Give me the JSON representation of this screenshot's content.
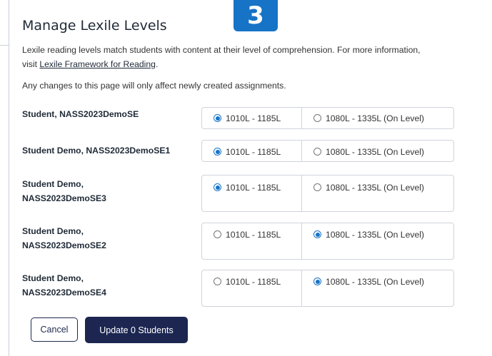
{
  "step_badge": "3",
  "modal": {
    "title": "Manage Lexile Levels",
    "description_prefix": "Lexile reading levels match students with content at their level of comprehension. For more information,",
    "description_visit": "visit ",
    "description_link": "Lexile Framework for Reading",
    "description_suffix": ".",
    "notice": "Any changes to this page will only affect newly created assignments."
  },
  "students": [
    {
      "name": "Student, NASS2023DemoSE",
      "option_a": "1010L - 1185L",
      "option_b": "1080L - 1335L (On Level)",
      "selected": "a"
    },
    {
      "name": "Student Demo, NASS2023DemoSE1",
      "option_a": "1010L - 1185L",
      "option_b": "1080L - 1335L (On Level)",
      "selected": "a"
    },
    {
      "name": "Student Demo, NASS2023DemoSE3",
      "option_a": "1010L - 1185L",
      "option_b": "1080L - 1335L (On Level)",
      "selected": "a"
    },
    {
      "name": "Student Demo, NASS2023DemoSE2",
      "option_a": "1010L - 1185L",
      "option_b": "1080L - 1335L (On Level)",
      "selected": "b"
    },
    {
      "name": "Student Demo, NASS2023DemoSE4",
      "option_a": "1010L - 1185L",
      "option_b": "1080L - 1335L (On Level)",
      "selected": "b"
    }
  ],
  "buttons": {
    "cancel_label": "Cancel",
    "update_label": "Update 0 Students"
  },
  "colors": {
    "accent": "#1673c6",
    "primary_button": "#1c2651"
  }
}
